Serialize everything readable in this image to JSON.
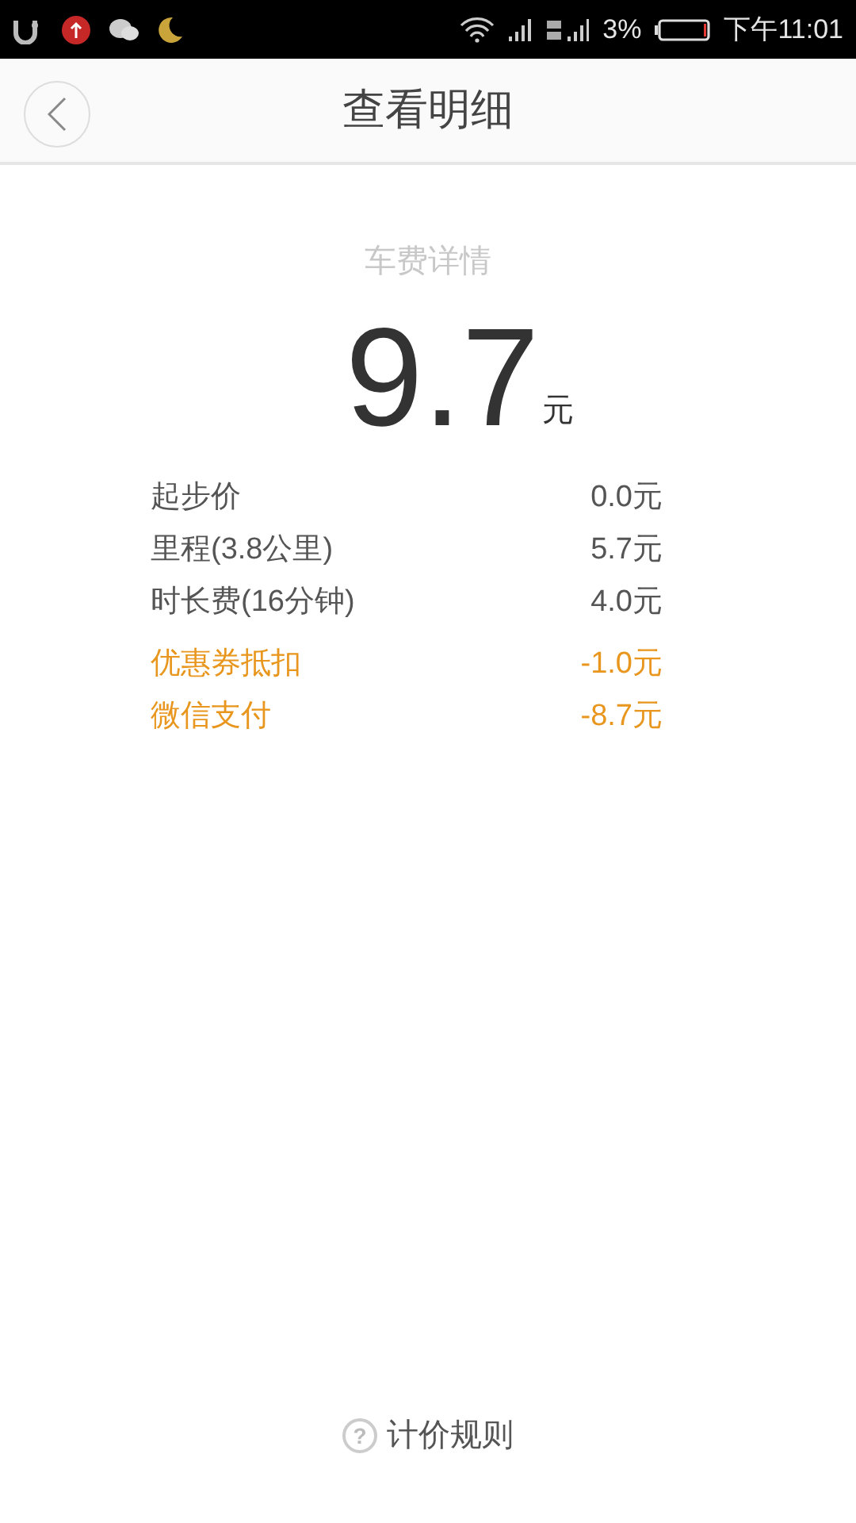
{
  "status_bar": {
    "battery": "3%",
    "time": "下午11:01"
  },
  "header": {
    "title": "查看明细"
  },
  "fare": {
    "label": "车费详情",
    "amount": "9.7",
    "unit": "元"
  },
  "items": [
    {
      "kind": "fee",
      "label": "起步价",
      "value": "0.0元"
    },
    {
      "kind": "fee",
      "label": "里程(3.8公里)",
      "value": "5.7元"
    },
    {
      "kind": "fee",
      "label": "时长费(16分钟)",
      "value": "4.0元"
    },
    {
      "kind": "discount",
      "label": "优惠券抵扣",
      "value": "-1.0元"
    },
    {
      "kind": "discount",
      "label": "微信支付",
      "value": "-8.7元"
    }
  ],
  "footer": {
    "link": "计价规则",
    "icon": "?"
  }
}
